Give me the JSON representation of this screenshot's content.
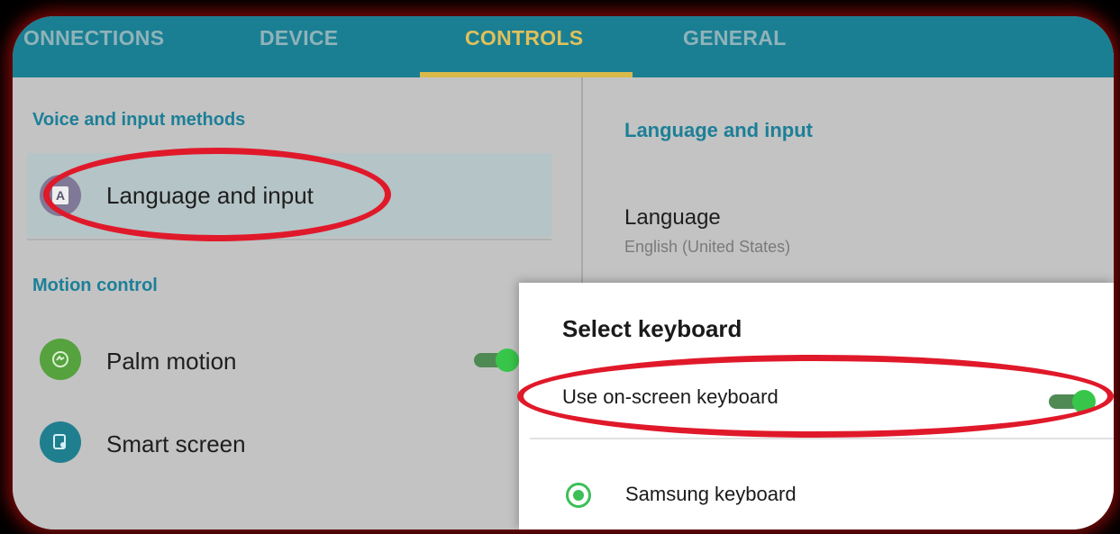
{
  "tabs": [
    {
      "label": "ONNECTIONS",
      "active": false
    },
    {
      "label": "DEVICE",
      "active": false
    },
    {
      "label": "CONTROLS",
      "active": true
    },
    {
      "label": "GENERAL",
      "active": false
    }
  ],
  "left_pane": {
    "voice_section": "Voice and input methods",
    "language_item": {
      "label": "Language and input",
      "icon": "language-icon",
      "selected": true
    },
    "motion_section": "Motion control",
    "palm_item": {
      "label": "Palm motion",
      "icon": "palm-motion-icon",
      "toggle_on": true
    },
    "smart_item": {
      "label": "Smart screen",
      "icon": "smart-screen-icon"
    }
  },
  "right_pane": {
    "header": "Language and input",
    "language": {
      "label": "Language",
      "value": "English (United States)"
    }
  },
  "dialog": {
    "title": "Select keyboard",
    "option": {
      "label": "Use on-screen keyboard",
      "toggle_on": true
    },
    "keyboard": {
      "label": "Samsung keyboard",
      "selected": true
    }
  },
  "colors": {
    "tabbar": "#1b7f93",
    "accent_tab": "#e0c15b",
    "section_header": "#1c7f97",
    "toggle_on": "#38c64a",
    "annotation": "#e0192a"
  }
}
